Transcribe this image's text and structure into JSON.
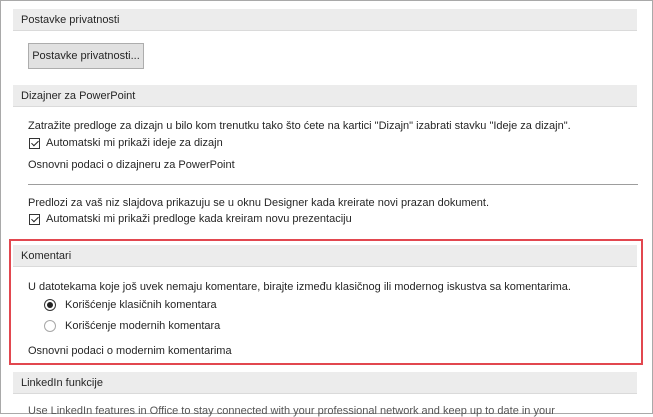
{
  "privacy": {
    "header": "Postavke privatnosti",
    "button": "Postavke privatnosti..."
  },
  "designer": {
    "header": "Dizajner za PowerPoint",
    "description": "Zatražite predloge za dizajn u bilo kom trenutku tako što ćete na kartici \"Dizajn\" izabrati stavku \"Ideje za dizajn\".",
    "auto_show_ideas": "Automatski mi prikaži ideje za dizajn",
    "about_link": "Osnovni podaci o dizajneru za PowerPoint",
    "suggestions_text": "Predlozi za vaš niz slajdova prikazuju se u oknu Designer kada kreirate novi prazan dokument.",
    "auto_show_suggestions": "Automatski mi prikaži predloge kada kreiram novu prezentaciju"
  },
  "comments": {
    "header": "Komentari",
    "description": "U datotekama koje još uvek nemaju komentare, birajte između klasičnog ili modernog iskustva sa komentarima.",
    "classic_option": "Korišćenje klasičnih komentara",
    "modern_option": "Korišćenje modernih komentara",
    "about_link": "Osnovni podaci o modernim komentarima",
    "selected": "classic"
  },
  "linkedin": {
    "header": "LinkedIn funkcije",
    "description": "Use LinkedIn features in Office to stay connected with your professional network and keep up to date in your"
  },
  "colors": {
    "highlight": "#e2474f",
    "section_bg": "#ececec"
  }
}
